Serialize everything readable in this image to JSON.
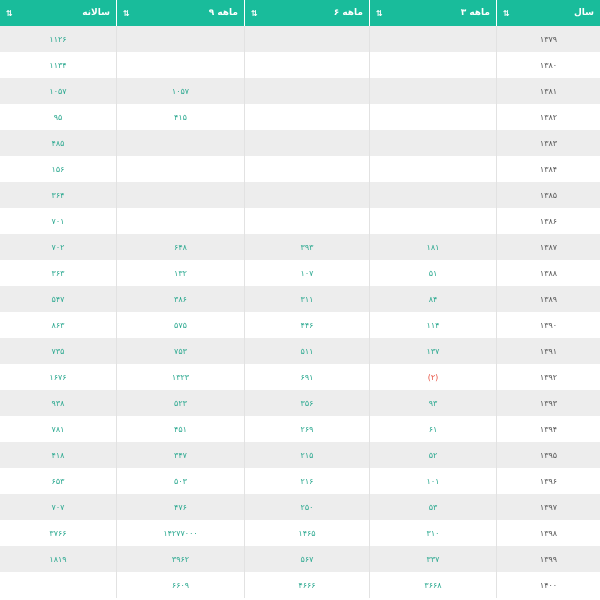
{
  "table": {
    "headers": {
      "year": "سال",
      "q3": "۳ ماهه",
      "q6": "۶ ماهه",
      "q9": "۹ ماهه",
      "annual": "سالانه"
    },
    "rows": [
      {
        "year": "۱۳۷۹",
        "q3": "",
        "q6": "",
        "q9": "",
        "annual": "۱۱۲۶"
      },
      {
        "year": "۱۳۸۰",
        "q3": "",
        "q6": "",
        "q9": "",
        "annual": "۱۱۳۴"
      },
      {
        "year": "۱۳۸۱",
        "q3": "",
        "q6": "",
        "q9": "۱۰۵۷",
        "annual": "۱۰۵۷"
      },
      {
        "year": "۱۳۸۲",
        "q3": "",
        "q6": "",
        "q9": "۴۱۵",
        "annual": "۹۵"
      },
      {
        "year": "۱۳۸۳",
        "q3": "",
        "q6": "",
        "q9": "",
        "annual": "۴۸۵"
      },
      {
        "year": "۱۳۸۴",
        "q3": "",
        "q6": "",
        "q9": "",
        "annual": "۱۵۶"
      },
      {
        "year": "۱۳۸۵",
        "q3": "",
        "q6": "",
        "q9": "",
        "annual": "۳۶۴"
      },
      {
        "year": "۱۳۸۶",
        "q3": "",
        "q6": "",
        "q9": "",
        "annual": "۷۰۱"
      },
      {
        "year": "۱۳۸۷",
        "q3": "۱۸۱",
        "q6": "۳۹۳",
        "q9": "۶۴۸",
        "annual": "۷۰۲"
      },
      {
        "year": "۱۳۸۸",
        "q3": "۵۱",
        "q6": "۱۰۷",
        "q9": "۱۳۲",
        "annual": "۳۶۳"
      },
      {
        "year": "۱۳۸۹",
        "q3": "۸۴",
        "q6": "۳۱۱",
        "q9": "۳۸۶",
        "annual": "۵۴۷"
      },
      {
        "year": "۱۳۹۰",
        "q3": "۱۱۴",
        "q6": "۴۴۶",
        "q9": "۵۷۵",
        "annual": "۸۶۳"
      },
      {
        "year": "۱۳۹۱",
        "q3": "۱۳۷",
        "q6": "۵۱۱",
        "q9": "۷۵۳",
        "annual": "۷۳۵"
      },
      {
        "year": "۱۳۹۲",
        "q3": "(۲)",
        "q6": "۶۹۱",
        "q9": "۱۳۲۳",
        "annual": "۱۶۷۶",
        "q3_negative": true
      },
      {
        "year": "۱۳۹۳",
        "q3": "۹۳",
        "q6": "۳۵۶",
        "q9": "۵۲۳",
        "annual": "۹۳۸"
      },
      {
        "year": "۱۳۹۴",
        "q3": "۶۱",
        "q6": "۲۶۹",
        "q9": "۴۵۱",
        "annual": "۷۸۱"
      },
      {
        "year": "۱۳۹۵",
        "q3": "۵۲",
        "q6": "۲۱۵",
        "q9": "۳۴۷",
        "annual": "۴۱۸"
      },
      {
        "year": "۱۳۹۶",
        "q3": "۱۰۱",
        "q6": "۲۱۶",
        "q9": "۵۰۳",
        "annual": "۶۵۳"
      },
      {
        "year": "۱۳۹۷",
        "q3": "۵۳",
        "q6": "۲۵۰",
        "q9": "۴۷۶",
        "annual": "۷۰۷"
      },
      {
        "year": "۱۳۹۸",
        "q3": "۳۱۰",
        "q6": "۱۴۶۵",
        "q9": "۱۴۲۷۷۰۰۰",
        "annual": "۳۷۶۶"
      },
      {
        "year": "۱۳۹۹",
        "q3": "۳۳۷",
        "q6": "۵۶۷",
        "q9": "۳۹۶۲",
        "annual": "۱۸۱۹"
      },
      {
        "year": "۱۴۰۰",
        "q3": "۳۶۶۸",
        "q6": "۴۶۶۶",
        "q9": "۶۶۰۹",
        "annual": ""
      }
    ]
  }
}
